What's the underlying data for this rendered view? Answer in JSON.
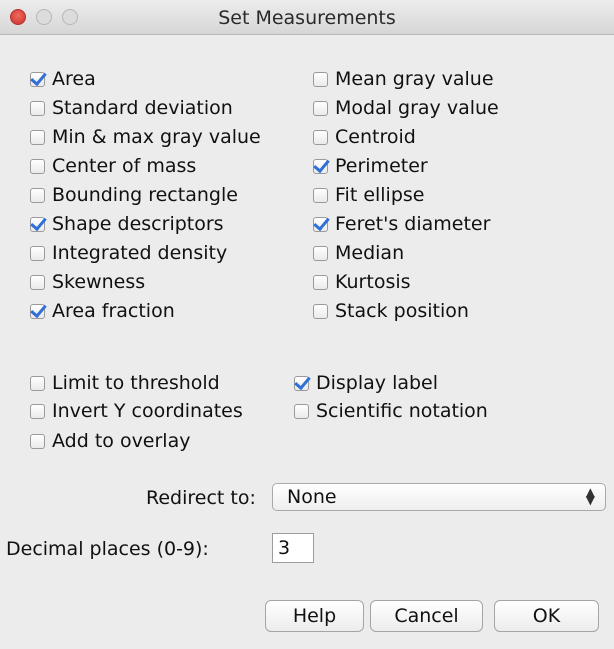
{
  "window": {
    "title": "Set Measurements"
  },
  "measurements": {
    "left": [
      {
        "label": "Area",
        "checked": true
      },
      {
        "label": "Standard deviation",
        "checked": false
      },
      {
        "label": "Min & max gray value",
        "checked": false
      },
      {
        "label": "Center of mass",
        "checked": false
      },
      {
        "label": "Bounding rectangle",
        "checked": false
      },
      {
        "label": "Shape descriptors",
        "checked": true
      },
      {
        "label": "Integrated density",
        "checked": false
      },
      {
        "label": "Skewness",
        "checked": false
      },
      {
        "label": "Area fraction",
        "checked": true
      }
    ],
    "right": [
      {
        "label": "Mean gray value",
        "checked": false
      },
      {
        "label": "Modal gray value",
        "checked": false
      },
      {
        "label": "Centroid",
        "checked": false
      },
      {
        "label": "Perimeter",
        "checked": true
      },
      {
        "label": "Fit ellipse",
        "checked": false
      },
      {
        "label": "Feret's diameter",
        "checked": true
      },
      {
        "label": "Median",
        "checked": false
      },
      {
        "label": "Kurtosis",
        "checked": false
      },
      {
        "label": "Stack position",
        "checked": false
      }
    ]
  },
  "options": {
    "limit_to_threshold": {
      "label": "Limit to threshold",
      "checked": false
    },
    "display_label": {
      "label": "Display label",
      "checked": true
    },
    "invert_y": {
      "label": "Invert Y coordinates",
      "checked": false
    },
    "scientific_notation": {
      "label": "Scientific notation",
      "checked": false
    },
    "add_to_overlay": {
      "label": "Add to overlay",
      "checked": false
    }
  },
  "redirect": {
    "label": "Redirect to:",
    "value": "None"
  },
  "decimal": {
    "label": "Decimal places (0-9):",
    "value": "3"
  },
  "buttons": {
    "help": "Help",
    "cancel": "Cancel",
    "ok": "OK"
  },
  "colors": {
    "accent": "#2f6fd6",
    "close": "#e0493f"
  }
}
